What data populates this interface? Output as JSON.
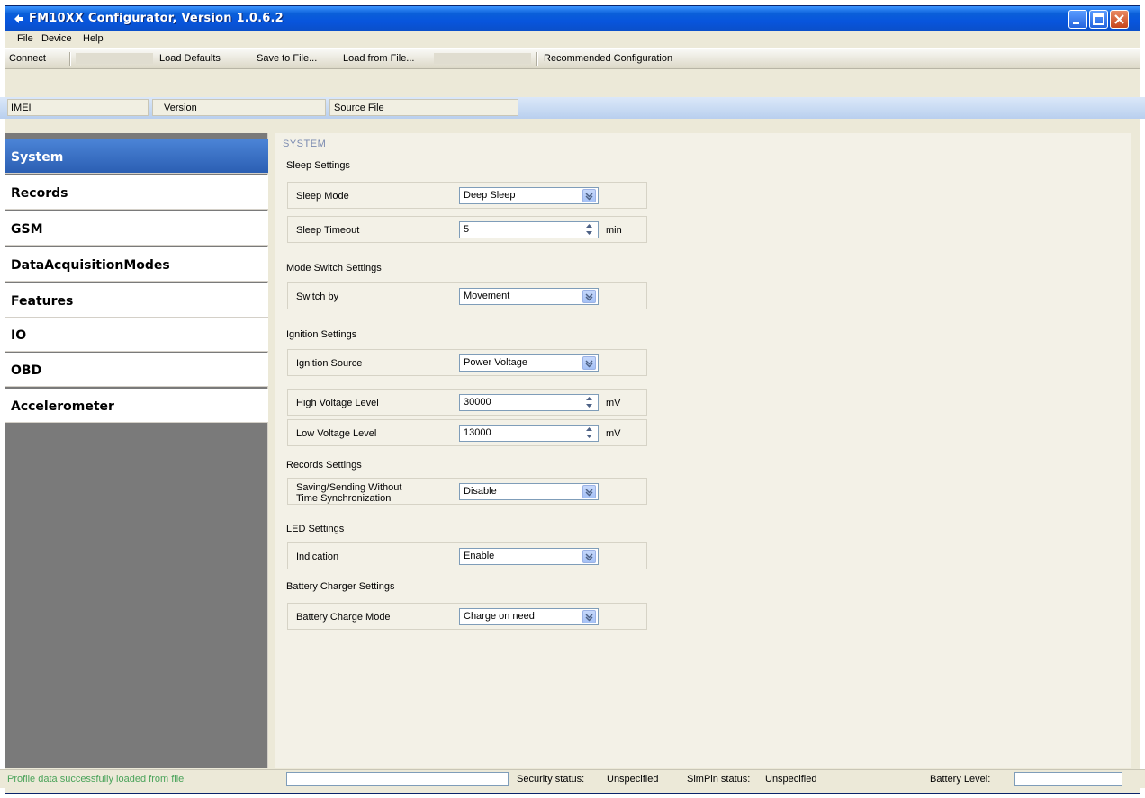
{
  "window": {
    "title": "FM10XX Configurator, Version 1.0.6.2"
  },
  "menu": [
    "File",
    "Device",
    "Help"
  ],
  "toolbar": {
    "connect": "Connect",
    "load_defaults": "Load Defaults",
    "save_to_file": "Save to File...",
    "load_from_file": "Load from File...",
    "recommended": "Recommended Configuration"
  },
  "info": {
    "imei_label": "IMEI",
    "version_label": "Version",
    "source_label": "Source",
    "source_value": "File"
  },
  "sidebar": {
    "items": [
      {
        "label": "System",
        "active": true
      },
      {
        "label": "Records"
      },
      {
        "label": "GSM"
      },
      {
        "label": "DataAcquisitionModes"
      },
      {
        "label": "Features"
      },
      {
        "label": "IO"
      },
      {
        "label": "OBD"
      },
      {
        "label": "Accelerometer"
      }
    ]
  },
  "content": {
    "section_title": "SYSTEM",
    "sleep": {
      "title": "Sleep Settings",
      "mode_label": "Sleep Mode",
      "mode_value": "Deep Sleep",
      "timeout_label": "Sleep Timeout",
      "timeout_value": "5",
      "timeout_unit": "min"
    },
    "mode_switch": {
      "title": "Mode Switch Settings",
      "switch_label": "Switch by",
      "switch_value": "Movement"
    },
    "ignition": {
      "title": "Ignition Settings",
      "source_label": "Ignition Source",
      "source_value": "Power Voltage",
      "high_label": "High Voltage Level",
      "high_value": "30000",
      "high_unit": "mV",
      "low_label": "Low Voltage Level",
      "low_value": "13000",
      "low_unit": "mV"
    },
    "records": {
      "title": "Records Settings",
      "saving_label_1": "Saving/Sending Without",
      "saving_label_2": "Time Synchronization",
      "saving_value": "Disable"
    },
    "led": {
      "title": "LED Settings",
      "indication_label": "Indication",
      "indication_value": "Enable"
    },
    "battery": {
      "title": "Battery Charger Settings",
      "mode_label": "Battery Charge Mode",
      "mode_value": "Charge on need"
    }
  },
  "status": {
    "message": "Profile data successfully loaded from file",
    "security_label": "Security status:",
    "security_value": "Unspecified",
    "simpin_label": "SimPin status:",
    "simpin_value": "Unspecified",
    "battery_label": "Battery Level:"
  }
}
